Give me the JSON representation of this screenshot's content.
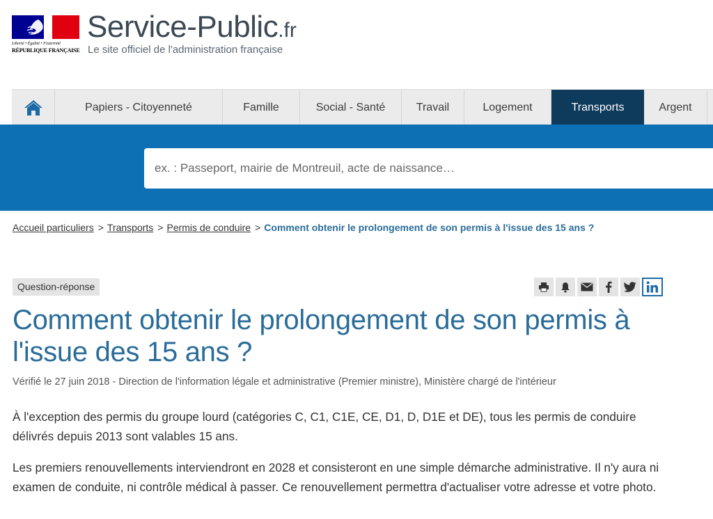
{
  "header": {
    "motto": "Liberté • Égalité • Fraternité",
    "republic": "RÉPUBLIQUE FRANÇAISE",
    "site_name": "Service-Public",
    "site_tld": ".fr",
    "tagline": "Le site officiel de l'administration française"
  },
  "nav": {
    "home_icon": "home-icon",
    "items": [
      {
        "label": "Papiers - Citoyenneté"
      },
      {
        "label": "Famille"
      },
      {
        "label": "Social - Santé"
      },
      {
        "label": "Travail"
      },
      {
        "label": "Logement"
      },
      {
        "label": "Transports",
        "active": true
      },
      {
        "label": "Argent"
      }
    ]
  },
  "search": {
    "placeholder": "ex. : Passeport, mairie de Montreuil, acte de naissance…"
  },
  "breadcrumb": {
    "items": [
      "Accueil particuliers",
      "Transports",
      "Permis de conduire"
    ],
    "separator": ">",
    "current": "Comment obtenir le prolongement de son permis à l'issue des 15 ans ?"
  },
  "content": {
    "badge": "Question-réponse",
    "tools": [
      "print-icon",
      "bell-icon",
      "mail-icon",
      "facebook-icon",
      "twitter-icon",
      "linkedin-icon"
    ],
    "title": "Comment obtenir le prolongement de son permis à l'issue des 15 ans ?",
    "verified": "Vérifié le 27 juin 2018 - Direction de l'information légale et administrative (Premier ministre), Ministère chargé de l'intérieur",
    "paragraphs": [
      "À l'exception des permis du groupe lourd (catégories C, C1, C1E, CE, D1, D, D1E et DE), tous les permis de conduire délivrés depuis 2013 sont valables 15 ans.",
      "Les premiers renouvellements interviendront en 2028 et consisteront en une simple démarche administrative. Il n'y aura ni examen de conduite, ni contrôle médical à passer. Ce renouvellement permettra d'actualiser votre adresse et votre photo."
    ]
  },
  "colors": {
    "brand_blue": "#0e70b4",
    "nav_active": "#0e3a5b",
    "title_blue": "#2a6c99",
    "flag_blue": "#000091",
    "flag_red": "#e1000f"
  }
}
